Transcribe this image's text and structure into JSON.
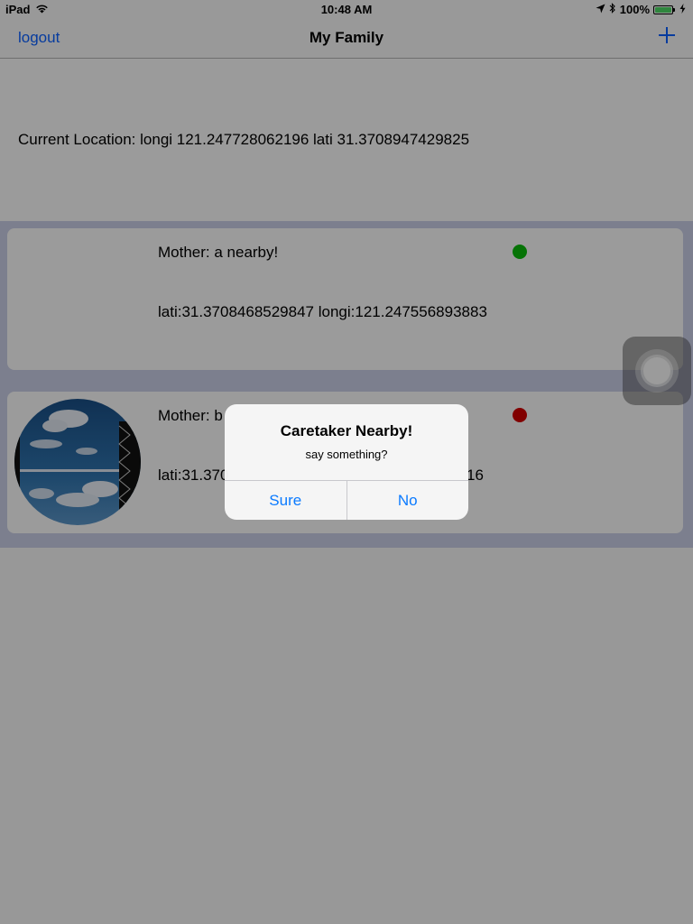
{
  "status_bar": {
    "device": "iPad",
    "time": "10:48 AM",
    "battery": "100%",
    "wifi_icon": "wifi-icon",
    "location_icon": "location-arrow-icon",
    "bluetooth_icon": "bluetooth-icon",
    "charging_icon": "charging-bolt-icon"
  },
  "nav": {
    "left_label": "logout",
    "title": "My Family",
    "add_icon": "plus-icon",
    "accent_color": "#0a5fff"
  },
  "location": {
    "text": "Current Location:  longi 121.247728062196 lati 31.3708947429825"
  },
  "members": [
    {
      "name": "Mother: a   nearby!",
      "coords": "lati:31.3708468529847 longi:121.247556893883",
      "status_color": "#0bba0b",
      "has_avatar": false
    },
    {
      "name": "Mother: b",
      "coords": "lati:31.370",
      "coords_tail": "16",
      "status_color": "#d10000",
      "has_avatar": true,
      "avatar_icon": "sky-photo-avatar"
    }
  ],
  "alert": {
    "title": "Caretaker Nearby!",
    "message": "say something?",
    "buttons": [
      "Sure",
      "No"
    ],
    "button_color": "#0a7aff"
  },
  "assistive_touch_icon": "assistive-touch-icon"
}
